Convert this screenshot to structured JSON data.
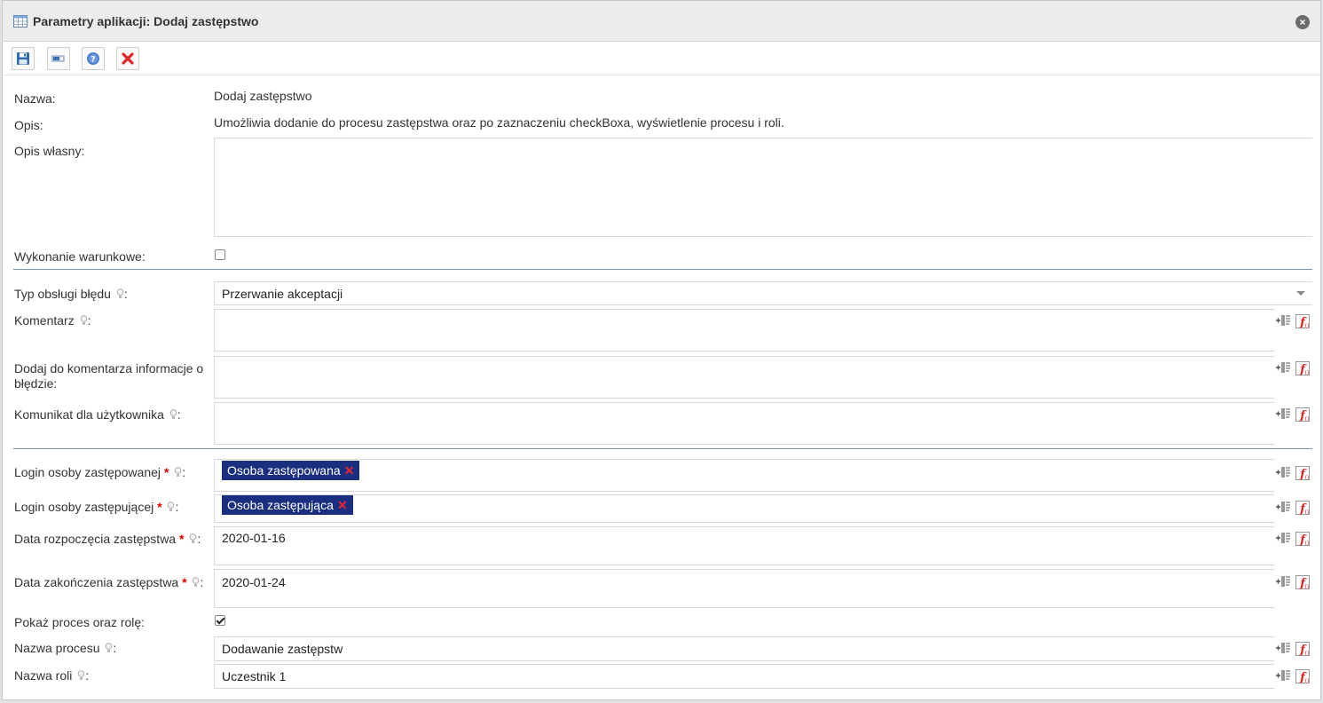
{
  "window": {
    "title": "Parametry aplikacji: Dodaj zastępstwo"
  },
  "fields": {
    "nazwa": {
      "label": "Nazwa:",
      "value": "Dodaj zastępstwo"
    },
    "opis": {
      "label": "Opis:",
      "value": "Umożliwia dodanie do procesu zastępstwa oraz po zaznaczeniu checkBoxa, wyświetlenie procesu i roli."
    },
    "opis_wlasny": {
      "label": "Opis własny:",
      "value": ""
    },
    "wykonanie": {
      "label": "Wykonanie warunkowe:",
      "checked": false
    },
    "typ_bledu": {
      "label": "Typ obsługi błędu",
      "value": "Przerwanie akceptacji"
    },
    "komentarz": {
      "label": "Komentarz",
      "value": ""
    },
    "dodaj_info": {
      "label": "Dodaj do komentarza informacje o błędzie:",
      "value": ""
    },
    "komunikat": {
      "label": "Komunikat dla użytkownika",
      "value": ""
    },
    "login_zastepowanej": {
      "label": "Login osoby zastępowanej",
      "tag": "Osoba zastępowana"
    },
    "login_zastepujacej": {
      "label": "Login osoby zastępującej",
      "tag": "Osoba zastępująca"
    },
    "data_rozpoczecia": {
      "label": "Data rozpoczęcia zastępstwa",
      "value": "2020-01-16"
    },
    "data_zakonczenia": {
      "label": "Data zakończenia zastępstwa",
      "value": "2020-01-24"
    },
    "pokaz": {
      "label": "Pokaż proces oraz rolę:",
      "checked": true
    },
    "nazwa_procesu": {
      "label": "Nazwa procesu",
      "value": "Dodawanie zastępstw"
    },
    "nazwa_roli": {
      "label": "Nazwa roli",
      "value": "Uczestnik 1"
    }
  },
  "common": {
    "colon": ":",
    "required_mark": "*",
    "remove_mark": "✕"
  },
  "icons": {
    "toolbar": [
      "save-icon",
      "window-icon",
      "help-icon",
      "close-red-icon"
    ],
    "side": [
      "insert-variable-icon",
      "function-icon"
    ],
    "hint": "lightbulb-icon"
  },
  "colors": {
    "tag_bg": "#1b2f80",
    "required": "#dd0000",
    "separator": "#7e99ab"
  }
}
